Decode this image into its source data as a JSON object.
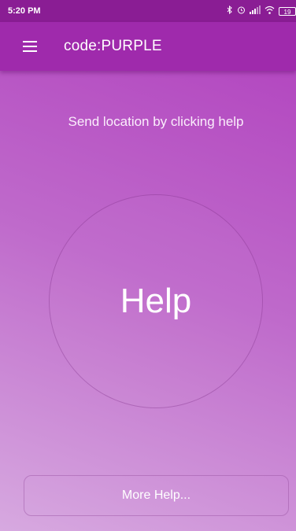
{
  "status_bar": {
    "time": "5:20 PM",
    "battery": "19",
    "icons": [
      "bluetooth-icon",
      "alarm-icon",
      "signal-icon",
      "wifi-icon",
      "battery-icon"
    ]
  },
  "app_bar": {
    "title": "code:PURPLE",
    "menu_icon": "hamburger-menu-icon"
  },
  "main": {
    "instruction": "Send location by clicking help",
    "help_button_label": "Help",
    "more_help_label": "More Help..."
  },
  "colors": {
    "status_bar": "#8a1d94",
    "app_bar": "#9f2aac",
    "gradient_top": "#b348c0",
    "gradient_bottom": "#d7a9e0",
    "text": "#ffffff"
  }
}
